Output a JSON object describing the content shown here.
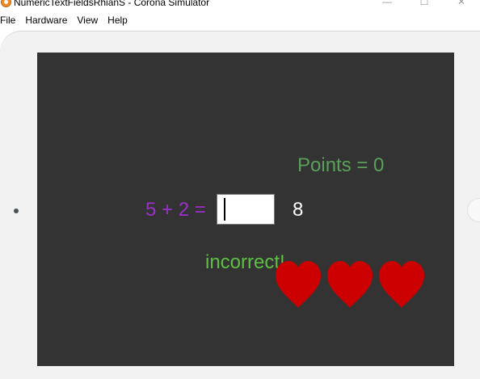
{
  "window": {
    "title": "NumericTextFieldsRhianS - Corona Simulator",
    "controls": [
      "—",
      "☐",
      "✕"
    ]
  },
  "menubar": {
    "items": [
      "File",
      "Hardware",
      "View",
      "Help"
    ]
  },
  "game": {
    "points_text": "Points = 0",
    "question_text": "5 + 2 =",
    "answer_input_value": "",
    "answer_display": "8",
    "feedback_text": "incorrect!",
    "lives_remaining": 3,
    "colors": {
      "background": "#333333",
      "points": "#5aa05a",
      "question": "#9b30c9",
      "answer": "#ffffff",
      "feedback": "#5fbf45",
      "heart": "#cc0000"
    }
  }
}
